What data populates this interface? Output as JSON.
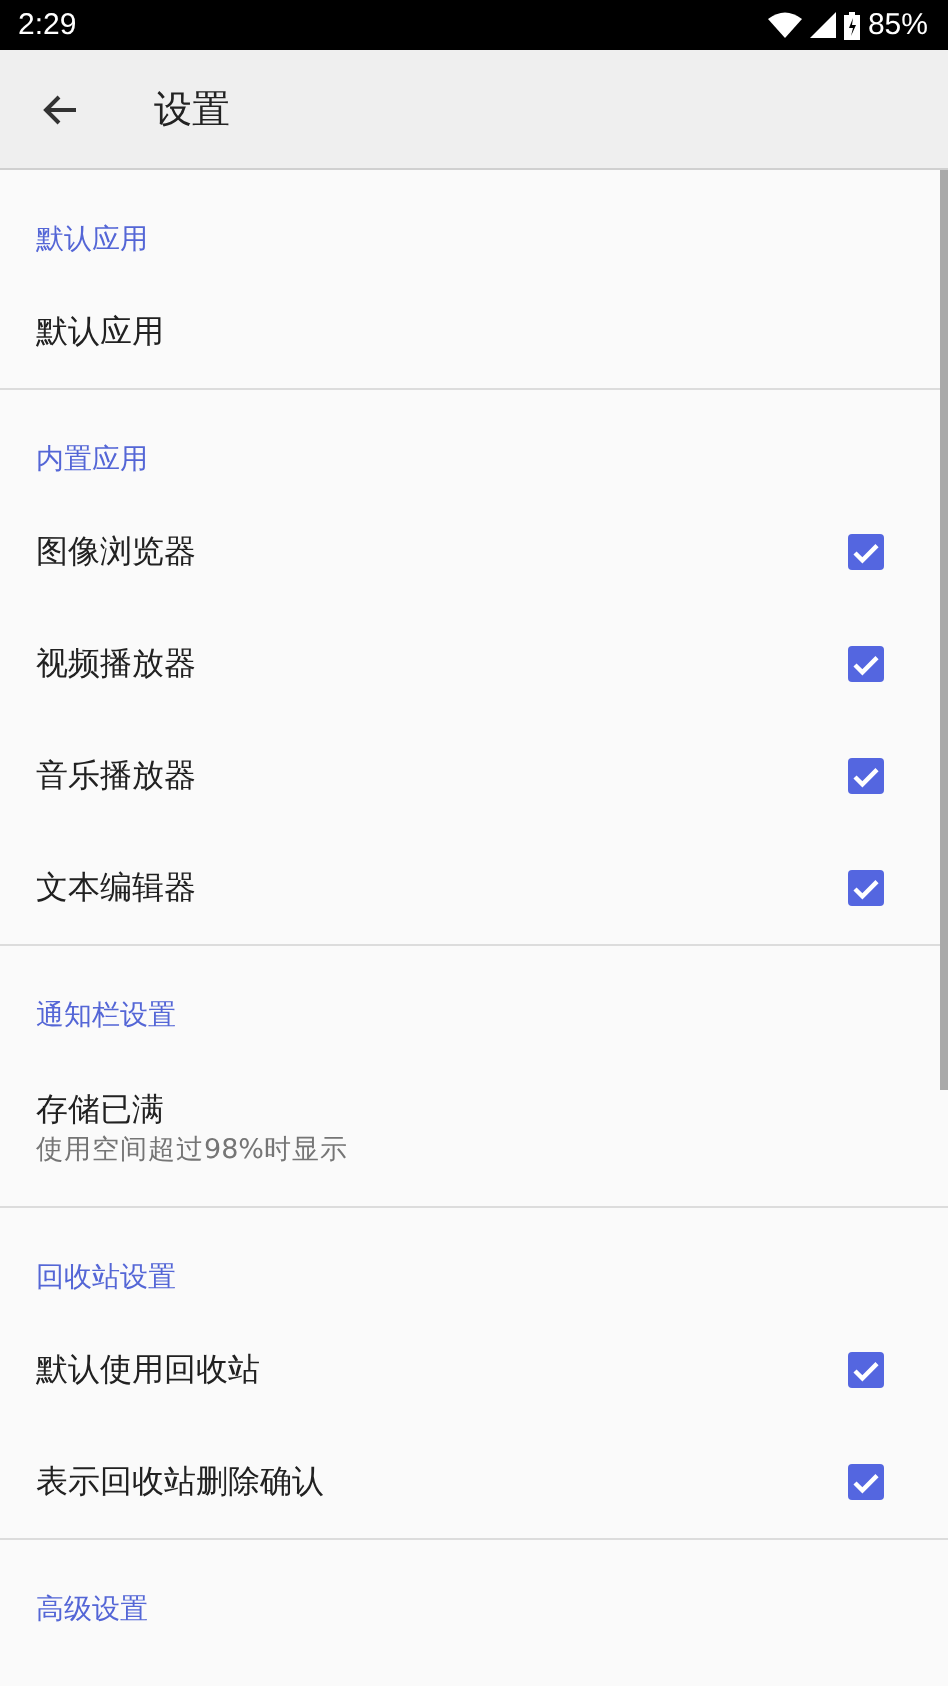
{
  "status_bar": {
    "time": "2:29",
    "battery": "85%"
  },
  "app_bar": {
    "title": "设置"
  },
  "sections": [
    {
      "header": "默认应用",
      "items": [
        {
          "kind": "plain",
          "title": "默认应用"
        }
      ]
    },
    {
      "header": "内置应用",
      "items": [
        {
          "kind": "checkbox",
          "title": "图像浏览器",
          "checked": true
        },
        {
          "kind": "checkbox",
          "title": "视频播放器",
          "checked": true
        },
        {
          "kind": "checkbox",
          "title": "音乐播放器",
          "checked": true
        },
        {
          "kind": "checkbox",
          "title": "文本编辑器",
          "checked": true
        }
      ]
    },
    {
      "header": "通知栏设置",
      "items": [
        {
          "kind": "plain",
          "title": "存储已满",
          "subtitle": "使用空间超过98%时显示"
        }
      ]
    },
    {
      "header": "回收站设置",
      "items": [
        {
          "kind": "checkbox",
          "title": "默认使用回收站",
          "checked": true
        },
        {
          "kind": "checkbox",
          "title": "表示回收站删除确认",
          "checked": true
        }
      ]
    },
    {
      "header": "高级设置"
    }
  ]
}
